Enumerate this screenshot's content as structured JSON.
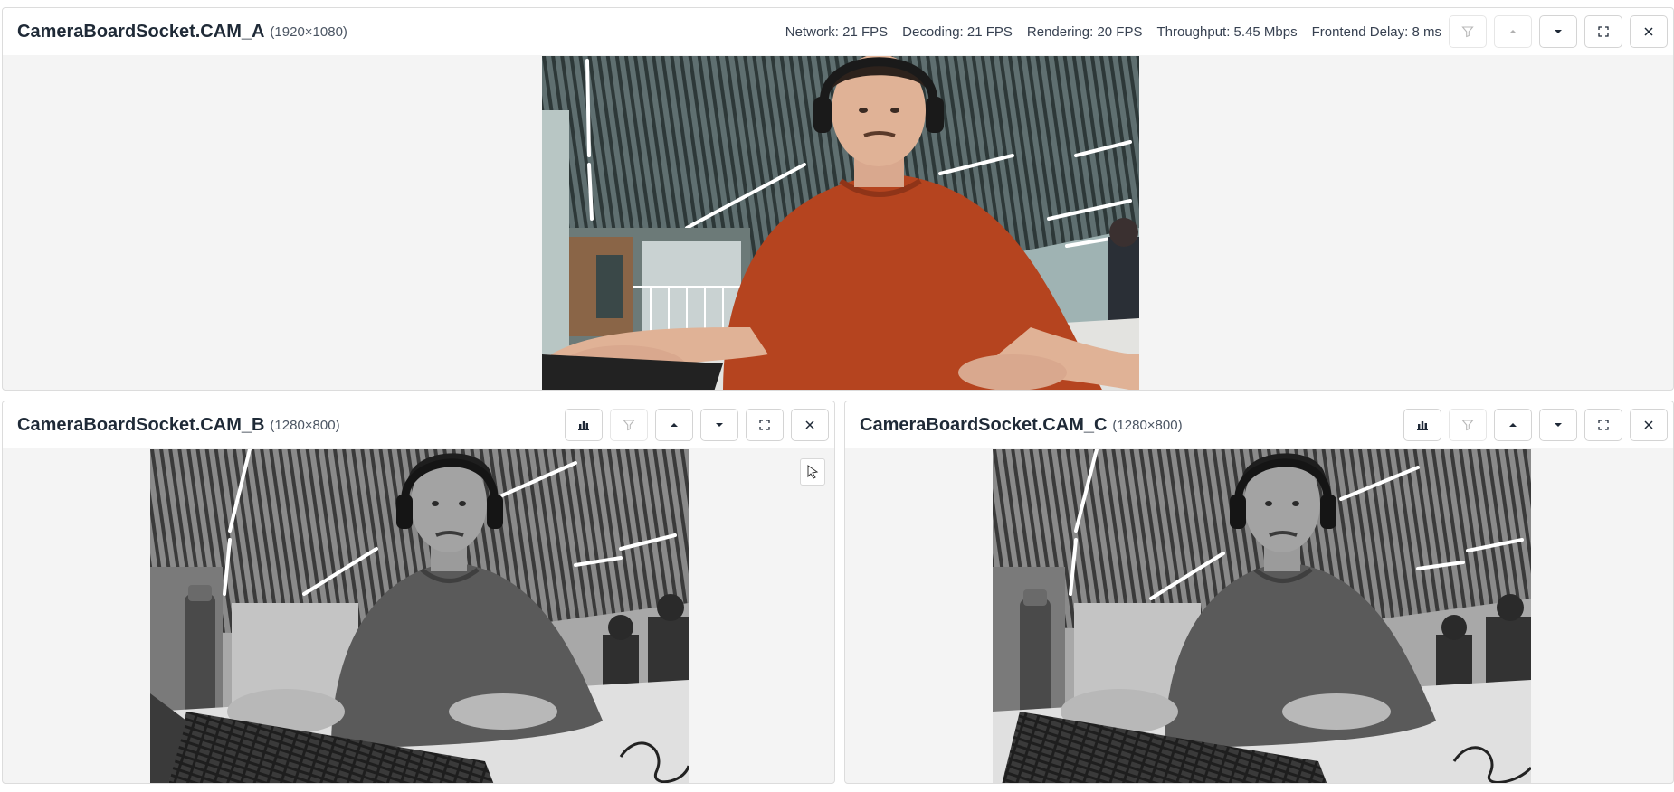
{
  "cameras": [
    {
      "title": "CameraBoardSocket.CAM_A",
      "resolution": "(1920×1080)",
      "stats": [
        "Network: 21 FPS",
        "Decoding: 21 FPS",
        "Rendering: 20 FPS",
        "Throughput: 5.45 Mbps",
        "Frontend Delay: 8 ms"
      ],
      "controls": [
        "filter-icon",
        "chevron-up-icon",
        "chevron-down-icon",
        "fullscreen-icon",
        "close-icon"
      ],
      "feed": "color"
    },
    {
      "title": "CameraBoardSocket.CAM_B",
      "resolution": "(1280×800)",
      "controls": [
        "stats-chart-icon",
        "filter-icon",
        "chevron-up-icon",
        "chevron-down-icon",
        "fullscreen-icon",
        "close-icon"
      ],
      "feed": "grayscale"
    },
    {
      "title": "CameraBoardSocket.CAM_C",
      "resolution": "(1280×800)",
      "controls": [
        "stats-chart-icon",
        "filter-icon",
        "chevron-up-icon",
        "chevron-down-icon",
        "fullscreen-icon",
        "close-icon"
      ],
      "feed": "grayscale"
    }
  ],
  "colors": {
    "panel_bg": "#f4f4f4",
    "header_bg": "#ffffff",
    "title_text": "#1f2a37",
    "shirt_color": "#b5441f"
  }
}
